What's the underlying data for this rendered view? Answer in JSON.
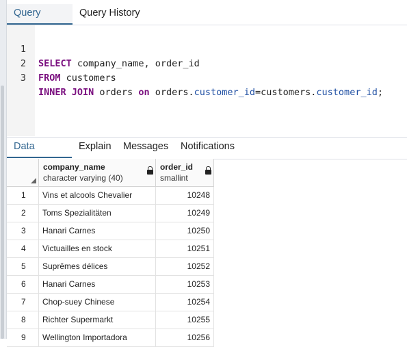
{
  "top_tabs": {
    "query_editor": "Query Editor",
    "query_history": "Query History"
  },
  "editor": {
    "lines": [
      {
        "number": "1",
        "text": "SELECT company_name, order_id"
      },
      {
        "number": "2",
        "text": "FROM customers"
      },
      {
        "number": "3",
        "text": "INNER JOIN orders on orders.customer_id=customers.customer_id;"
      }
    ]
  },
  "bottom_tabs": {
    "data_output": "Data Output",
    "explain": "Explain",
    "messages": "Messages",
    "notifications": "Notifications"
  },
  "grid": {
    "columns": [
      {
        "name": "company_name",
        "type": "character varying (40)"
      },
      {
        "name": "order_id",
        "type": "smallint"
      }
    ],
    "rows": [
      {
        "n": "1",
        "company_name": "Vins et alcools Chevalier",
        "order_id": "10248"
      },
      {
        "n": "2",
        "company_name": "Toms Spezialitäten",
        "order_id": "10249"
      },
      {
        "n": "3",
        "company_name": "Hanari Carnes",
        "order_id": "10250"
      },
      {
        "n": "4",
        "company_name": "Victuailles en stock",
        "order_id": "10251"
      },
      {
        "n": "5",
        "company_name": "Suprêmes délices",
        "order_id": "10252"
      },
      {
        "n": "6",
        "company_name": "Hanari Carnes",
        "order_id": "10253"
      },
      {
        "n": "7",
        "company_name": "Chop-suey Chinese",
        "order_id": "10254"
      },
      {
        "n": "8",
        "company_name": "Richter Supermarkt",
        "order_id": "10255"
      },
      {
        "n": "9",
        "company_name": "Wellington Importadora",
        "order_id": "10256"
      }
    ]
  },
  "colors": {
    "accent": "#326690",
    "keyword": "#7a0f7f",
    "identifier": "#1f4fa3"
  }
}
